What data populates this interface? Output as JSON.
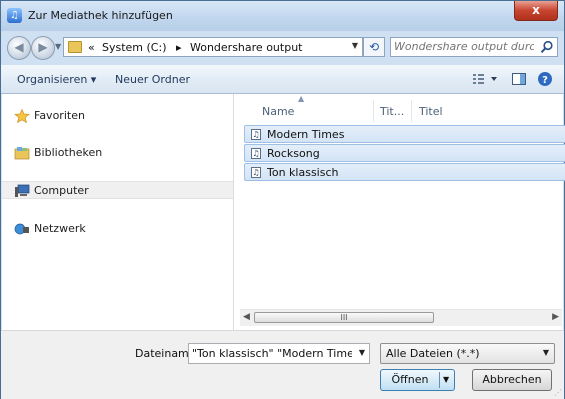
{
  "window": {
    "title": "Zur Mediathek hinzufügen",
    "close_label": "x"
  },
  "address": {
    "prefix": "«",
    "crumbs": [
      "System (C:)",
      "Wondershare output"
    ],
    "separator": "▸",
    "search_placeholder": "Wondershare output durchsuc..."
  },
  "toolbar": {
    "organize_label": "Organisieren ▾",
    "new_folder_label": "Neuer Ordner"
  },
  "nav": {
    "items": [
      {
        "label": "Favoriten",
        "icon": "star-icon"
      },
      {
        "label": "Bibliotheken",
        "icon": "library-icon"
      },
      {
        "label": "Computer",
        "icon": "computer-icon"
      },
      {
        "label": "Netzwerk",
        "icon": "network-icon"
      }
    ],
    "selected": "Computer"
  },
  "files": {
    "columns": [
      "Name",
      "Tit...",
      "Titel"
    ],
    "rows": [
      {
        "name": "Modern Times"
      },
      {
        "name": "Rocksong"
      },
      {
        "name": "Ton klassisch"
      }
    ],
    "scroll_thumb_label": "III"
  },
  "footer": {
    "filename_label": "Dateiname:",
    "filename_value": "\"Ton klassisch\" \"Modern Times\"",
    "filetype_value": "Alle Dateien (*.*)",
    "open_label": "Öffnen",
    "cancel_label": "Abbrechen"
  },
  "colors": {
    "selection": "#d3e4f6",
    "selection_border": "#9ec0e6",
    "toolbar_text": "#1e395b"
  }
}
